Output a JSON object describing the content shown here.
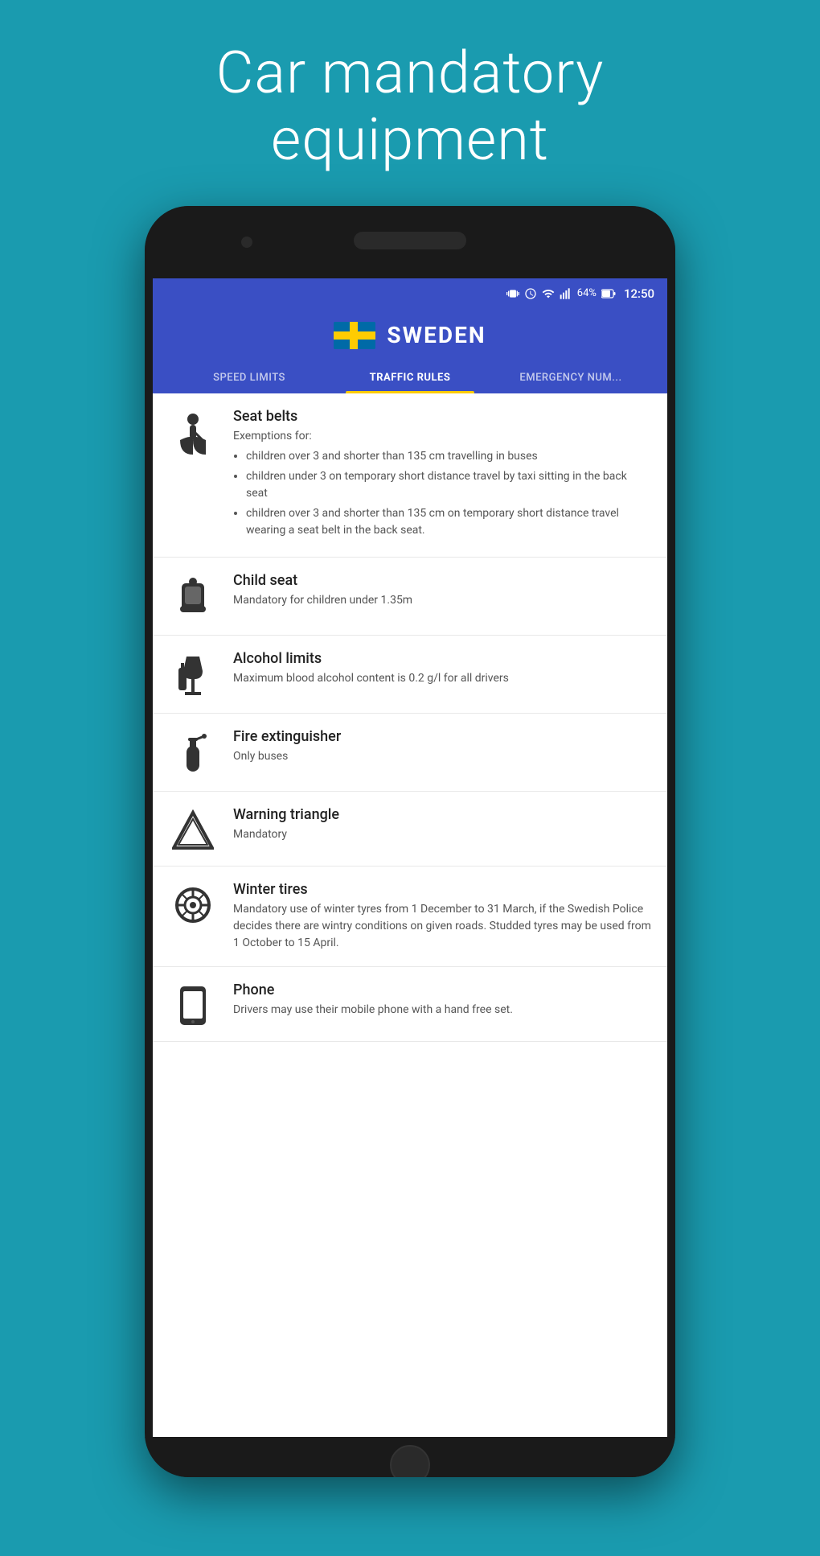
{
  "page": {
    "background_color": "#1a9baf",
    "title": "Car mandatory\nequipment"
  },
  "status_bar": {
    "time": "12:50",
    "battery": "64%",
    "icons": [
      "vibrate",
      "alarm",
      "wifi",
      "signal",
      "battery"
    ]
  },
  "header": {
    "country": "SWEDEN",
    "tabs": [
      {
        "label": "SPEED LIMITS",
        "active": false
      },
      {
        "label": "TRAFFIC RULES",
        "active": true
      },
      {
        "label": "EMERGENCY NUM...",
        "active": false
      }
    ]
  },
  "items": [
    {
      "id": "seat-belts",
      "title": "Seat belts",
      "description": "Exemptions for:",
      "bullets": [
        "children over 3 and shorter than 135 cm travelling in buses",
        "children under 3 on temporary short distance travel by taxi sitting in the back seat",
        "children over 3 and shorter than 135 cm on temporary short distance travel wearing a seat belt in the back seat."
      ]
    },
    {
      "id": "child-seat",
      "title": "Child seat",
      "description": "Mandatory for children under 1.35m"
    },
    {
      "id": "alcohol-limits",
      "title": "Alcohol limits",
      "description": "Maximum blood alcohol content is 0.2 g/l for all drivers"
    },
    {
      "id": "fire-extinguisher",
      "title": "Fire extinguisher",
      "description": "Only buses"
    },
    {
      "id": "warning-triangle",
      "title": "Warning triangle",
      "description": "Mandatory"
    },
    {
      "id": "winter-tires",
      "title": "Winter tires",
      "description": "Mandatory use of winter tyres from 1 December to 31 March, if the Swedish Police decides there are wintry conditions on given roads. Studded tyres may be used from 1 October to 15 April."
    },
    {
      "id": "phone",
      "title": "Phone",
      "description": "Drivers may use their mobile phone with a hand free set."
    }
  ]
}
